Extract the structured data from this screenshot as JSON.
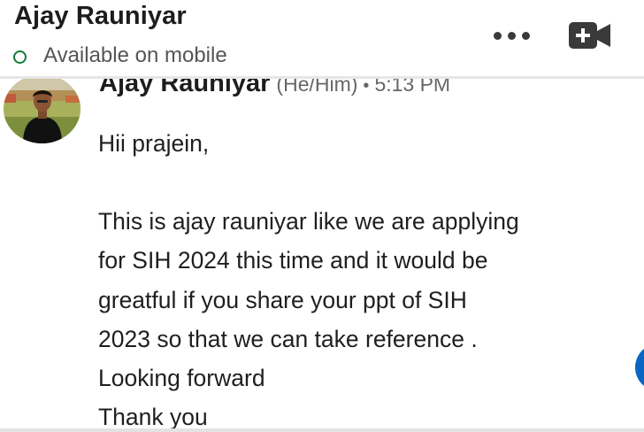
{
  "header": {
    "contact_name": "Ajay Rauniyar",
    "presence_status": "Available on mobile",
    "presence_color": "#137a3c",
    "more_icon": "ellipsis-horizontal-icon",
    "video_icon": "video-call-icon"
  },
  "message": {
    "sender_name": "Ajay Rauniyar",
    "pronouns": "(He/Him)",
    "separator": "•",
    "time": "5:13 PM",
    "avatar": "profile-photo",
    "lines": [
      "Hii prajein,",
      "",
      "This is ajay rauniyar like we are applying",
      "for SIH 2024 this time and it would be",
      "greatful if you share your ppt of SIH",
      "2023 so that we can take reference .",
      "Looking forward",
      "Thank you"
    ]
  },
  "colors": {
    "brand_blue": "#0a66c2",
    "text_primary": "#1f1f1f",
    "text_secondary": "#666666"
  }
}
